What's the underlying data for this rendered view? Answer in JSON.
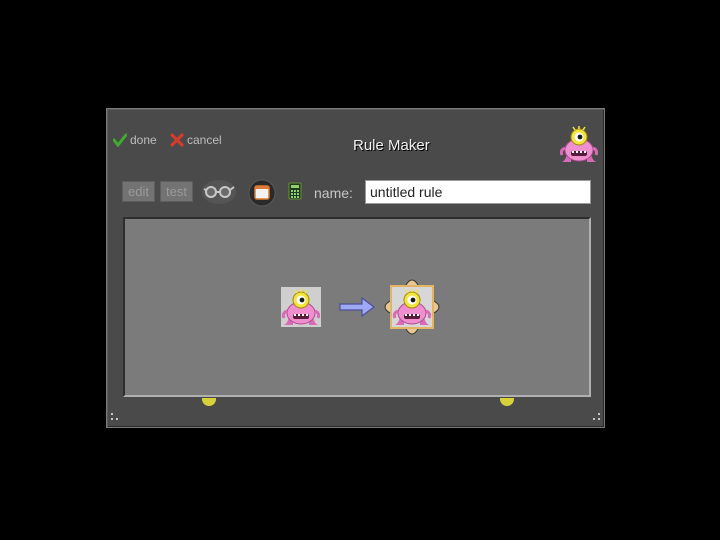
{
  "window": {
    "title": "Rule Maker",
    "done_label": "done",
    "cancel_label": "cancel"
  },
  "toolbar": {
    "edit_label": "edit",
    "test_label": "test",
    "glasses_icon": "glasses-icon",
    "tv_icon": "tv-icon",
    "calculator_icon": "calculator-icon",
    "name_label": "name:",
    "name_value": "untitled rule"
  },
  "rule": {
    "before_icon": "pink-monster-icon",
    "arrow_icon": "arrow-right-icon",
    "after_icon": "pink-monster-icon"
  },
  "colors": {
    "done": "#3faa2e",
    "cancel": "#d63a2a",
    "arrow": "#9fa8f2",
    "selection": "#e2b463"
  }
}
